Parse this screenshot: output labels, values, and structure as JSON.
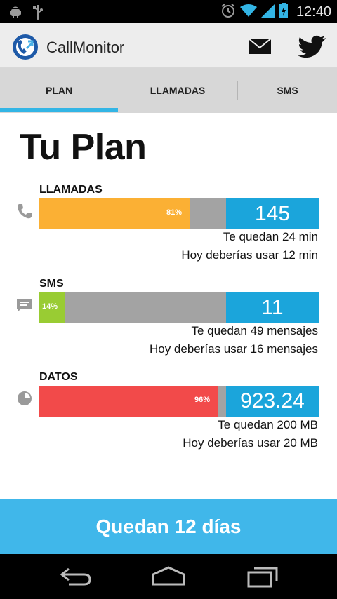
{
  "status_bar": {
    "time": "12:40",
    "icons": [
      "android-debug-icon",
      "usb-icon",
      "alarm-icon",
      "wifi-icon",
      "signal-icon",
      "battery-icon"
    ]
  },
  "app_bar": {
    "title": "CallMonitor",
    "actions": [
      "mail-icon",
      "twitter-icon"
    ]
  },
  "tabs": [
    {
      "label": "PLAN",
      "selected": true
    },
    {
      "label": "LLAMADAS",
      "selected": false
    },
    {
      "label": "SMS",
      "selected": false
    }
  ],
  "plan": {
    "title": "Tu Plan",
    "sections": [
      {
        "label": "LLAMADAS",
        "icon": "phone-icon",
        "percent_label": "81%",
        "percent": 0.81,
        "color": "#fbb034",
        "value": "145",
        "remaining": "Te quedan 24 min",
        "suggestion": "Hoy deberías usar 12 min"
      },
      {
        "label": "SMS",
        "icon": "message-icon",
        "percent_label": "14%",
        "percent": 0.14,
        "color": "#99cc33",
        "value": "11",
        "remaining": "Te quedan 49 mensajes",
        "suggestion": "Hoy deberías usar 16 mensajes"
      },
      {
        "label": "DATOS",
        "icon": "data-pie-icon",
        "percent_label": "96%",
        "percent": 0.96,
        "color": "#f24a4a",
        "value": "923.24",
        "remaining": "Te quedan 200 MB",
        "suggestion": "Hoy deberías usar 20 MB"
      }
    ]
  },
  "footer": {
    "text": "Quedan 12 días"
  },
  "nav_bar": [
    "back-icon",
    "home-icon",
    "recents-icon"
  ],
  "colors": {
    "accent": "#33b5e5",
    "value_box": "#1ba5db",
    "footer": "#40b7ea",
    "bar_remaining": "#a3a3a3"
  }
}
